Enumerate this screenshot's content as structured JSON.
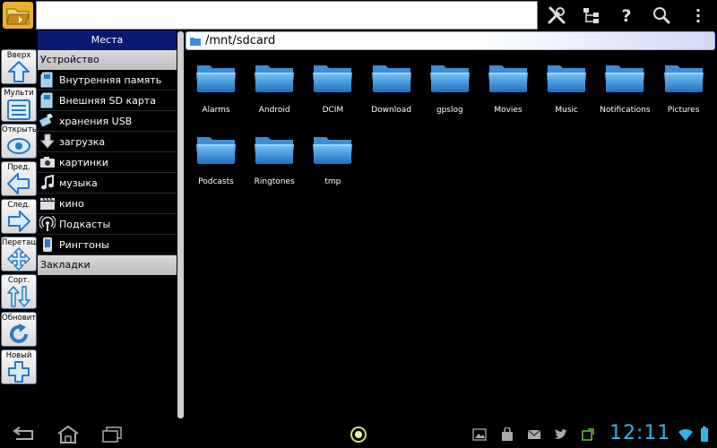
{
  "topbar": {
    "path_value": "",
    "actions": [
      "tools-icon",
      "tree-icon",
      "help-icon",
      "search-icon",
      "overflow-menu-icon"
    ]
  },
  "toolbar": {
    "up": "Вверх",
    "multi": "Мульти",
    "open": "Открыть",
    "prev": "Пред.",
    "next": "След.",
    "drag": "Перетащ.",
    "sort": "Сорт.",
    "refresh": "Обновить",
    "new": "Новый"
  },
  "places": {
    "title": "Места",
    "device_header": "Устройство",
    "items": [
      {
        "label": "Внутренняя память",
        "icon": "sdcard-icon"
      },
      {
        "label": "Внешняя SD карта",
        "icon": "sdcard-icon"
      },
      {
        "label": "хранения USB",
        "icon": "usb-icon"
      },
      {
        "label": "загрузка",
        "icon": "download-icon"
      },
      {
        "label": "картинки",
        "icon": "camera-icon"
      },
      {
        "label": "музыка",
        "icon": "music-icon"
      },
      {
        "label": "кино",
        "icon": "clapper-icon"
      },
      {
        "label": "Подкасты",
        "icon": "podcast-icon"
      },
      {
        "label": "Рингтоны",
        "icon": "ringtone-icon"
      }
    ],
    "bookmarks_header": "Закладки"
  },
  "main": {
    "path": "/mnt/sdcard",
    "folders": [
      "Alarms",
      "Android",
      "DCIM",
      "Download",
      "gpslog",
      "Movies",
      "Music",
      "Notifications",
      "Pictures",
      "Podcasts",
      "Ringtones",
      "tmp"
    ]
  },
  "status": {
    "time": "12:11",
    "accent": "#2fb4e9"
  }
}
